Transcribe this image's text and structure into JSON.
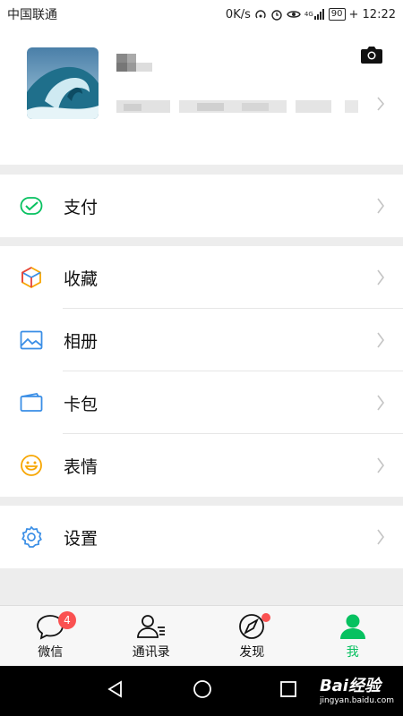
{
  "status_bar": {
    "carrier": "中国联通",
    "speed": "0K/s",
    "network": "4G",
    "battery": "90",
    "time": "+ 12:22"
  },
  "profile": {
    "camera_icon": "camera-icon"
  },
  "menu": {
    "pay": {
      "label": "支付",
      "icon": "wallet-check-icon"
    },
    "favorites": {
      "label": "收藏",
      "icon": "cube-icon"
    },
    "album": {
      "label": "相册",
      "icon": "image-icon"
    },
    "cards": {
      "label": "卡包",
      "icon": "card-icon"
    },
    "stickers": {
      "label": "表情",
      "icon": "smiley-icon"
    },
    "settings": {
      "label": "设置",
      "icon": "gear-icon"
    }
  },
  "tabs": [
    {
      "label": "微信",
      "badge": "4",
      "icon": "chat-icon"
    },
    {
      "label": "通讯录",
      "icon": "contacts-icon"
    },
    {
      "label": "发现",
      "icon": "compass-icon",
      "dot": true
    },
    {
      "label": "我",
      "icon": "person-icon",
      "active": true
    }
  ],
  "watermark": {
    "brand": "Bai经验",
    "url": "jingyan.baidu.com"
  },
  "colors": {
    "accent": "#07c160",
    "badge": "#fa5151",
    "background": "#ededed"
  }
}
